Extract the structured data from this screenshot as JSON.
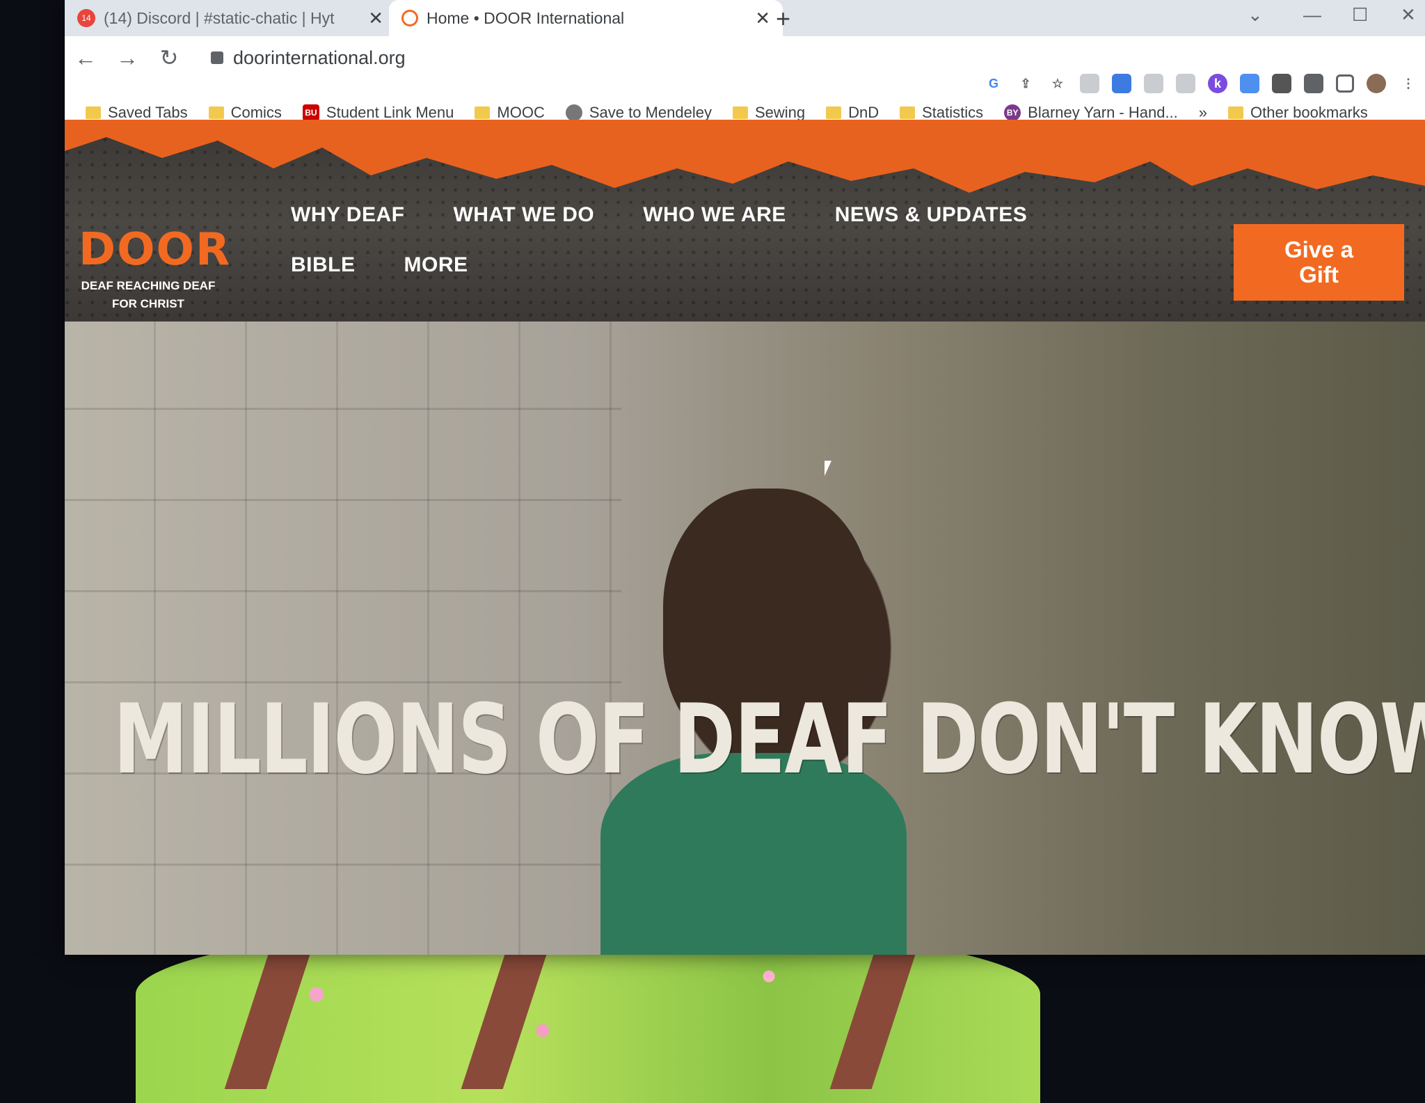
{
  "browser": {
    "tabs": [
      {
        "title": "(14) Discord | #static-chatic | Hyt",
        "badge": "14",
        "active": false
      },
      {
        "title": "Home • DOOR International",
        "active": true
      }
    ],
    "new_tab": "+",
    "address": "doorinternational.org",
    "bookmarks": [
      {
        "label": "Saved Tabs",
        "icon": "folder-icon"
      },
      {
        "label": "Comics",
        "icon": "folder-icon"
      },
      {
        "label": "Student Link Menu",
        "icon": "bu-icon",
        "badge": "BU"
      },
      {
        "label": "MOOC",
        "icon": "folder-icon"
      },
      {
        "label": "Save to Mendeley",
        "icon": "mendeley-icon"
      },
      {
        "label": "Sewing",
        "icon": "folder-icon"
      },
      {
        "label": "DnD",
        "icon": "folder-icon"
      },
      {
        "label": "Statistics",
        "icon": "folder-icon"
      },
      {
        "label": "Blarney Yarn - Hand...",
        "icon": "by-icon",
        "badge": "BY"
      }
    ],
    "overflow": "»",
    "other_bookmarks": "Other bookmarks"
  },
  "site": {
    "logo": {
      "word": "DOOR",
      "tagline_1": "DEAF REACHING DEAF",
      "tagline_2": "FOR CHRIST"
    },
    "nav": [
      "WHY DEAF",
      "WHAT WE DO",
      "WHO WE ARE",
      "NEWS & UPDATES",
      "BIBLE",
      "MORE"
    ],
    "cta_line1": "Give a",
    "cta_line2": "Gift",
    "hero_title": "MILLIONS OF DEAF DON'T KNOW GOD...",
    "colors": {
      "brand_orange": "#f26a21",
      "header_dark": "#3f3c39"
    }
  }
}
